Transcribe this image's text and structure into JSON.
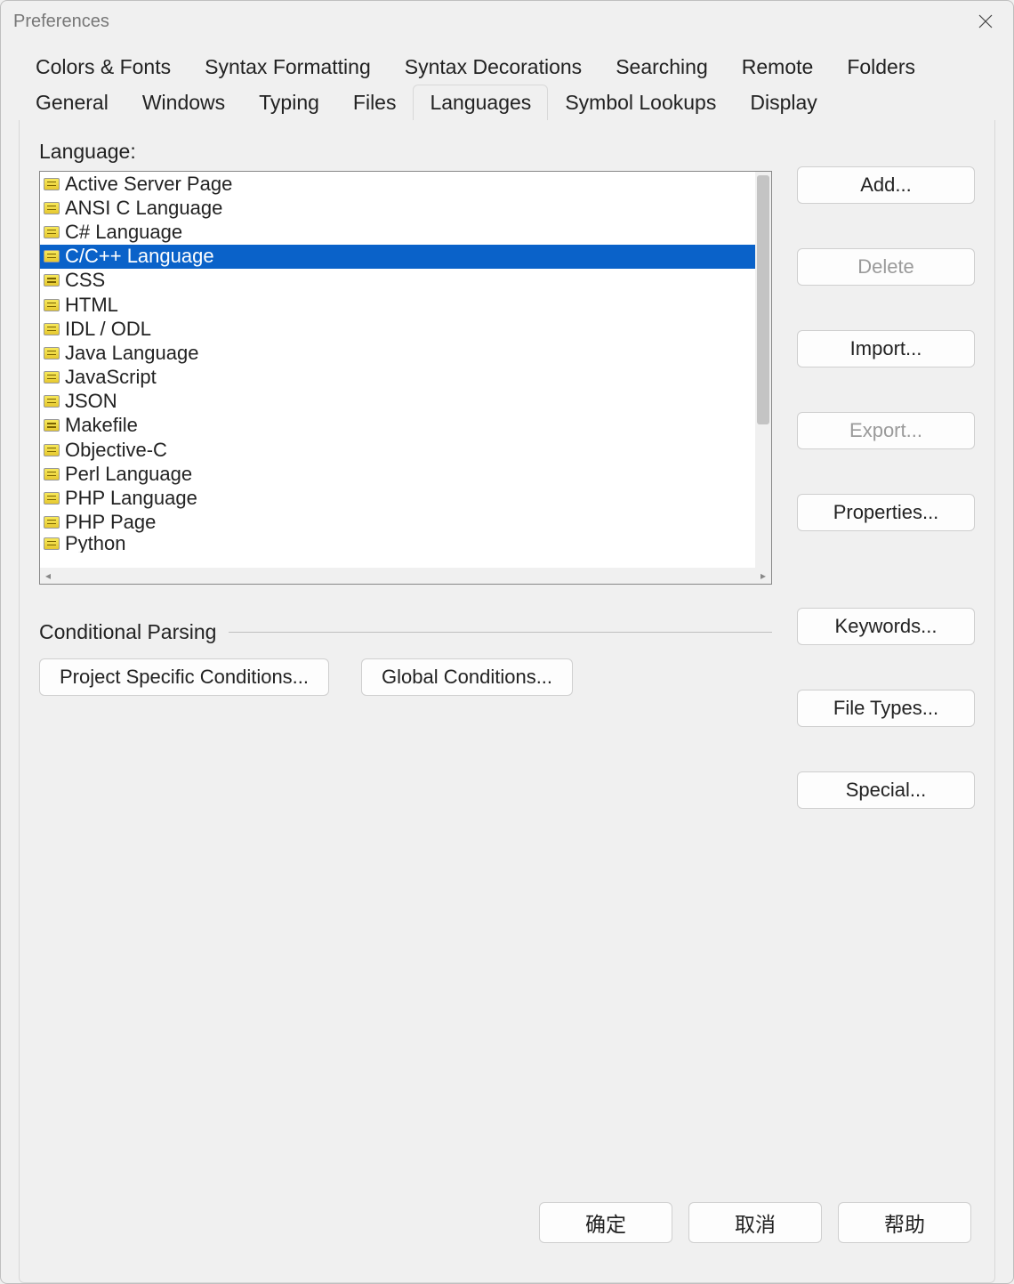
{
  "window": {
    "title": "Preferences"
  },
  "tabs_row1": [
    {
      "label": "Colors & Fonts"
    },
    {
      "label": "Syntax Formatting"
    },
    {
      "label": "Syntax Decorations"
    },
    {
      "label": "Searching"
    },
    {
      "label": "Remote"
    },
    {
      "label": "Folders"
    }
  ],
  "tabs_row2": [
    {
      "label": "General"
    },
    {
      "label": "Windows"
    },
    {
      "label": "Typing"
    },
    {
      "label": "Files"
    },
    {
      "label": "Languages",
      "active": true
    },
    {
      "label": "Symbol Lookups"
    },
    {
      "label": "Display"
    }
  ],
  "languages": {
    "label": "Language:",
    "selected_index": 3,
    "items": [
      "Active Server Page",
      "ANSI C Language",
      "C# Language",
      "C/C++ Language",
      "CSS",
      "HTML",
      "IDL / ODL",
      "Java Language",
      "JavaScript",
      "JSON",
      "Makefile",
      "Objective-C",
      "Perl Language",
      "PHP Language",
      "PHP Page",
      "Python"
    ]
  },
  "side_buttons": {
    "add": "Add...",
    "delete": "Delete",
    "import": "Import...",
    "export": "Export...",
    "properties": "Properties...",
    "keywords": "Keywords...",
    "file_types": "File Types...",
    "special": "Special..."
  },
  "conditional": {
    "title": "Conditional Parsing",
    "project_btn": "Project Specific Conditions...",
    "global_btn": "Global Conditions..."
  },
  "footer": {
    "ok": "确定",
    "cancel": "取消",
    "help": "帮助"
  }
}
